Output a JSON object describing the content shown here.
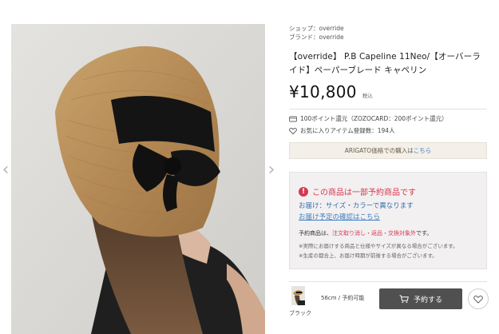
{
  "product": {
    "shop_line": "ショップ：override",
    "brand_line": "ブランド：override",
    "title": "【override】 P.B Capeline 11Neo/【オーバーライド】ペーパーブレード キャペリン",
    "price": "¥10,800",
    "tax_label": "税込",
    "points_text": "100ポイント還元（ZOZOCARD：200ポイント還元）",
    "favorites_text": "お気に入りアイテム登録数：194人"
  },
  "arigato": {
    "prefix": "ARIGATO価格での購入は",
    "link": "こちら"
  },
  "notice": {
    "headline": "この商品は一部予約商品です",
    "size_color": "お届け：サイズ・カラーで異なります",
    "check_link": "お届け予定の確認はこちら",
    "cancel_prefix": "予約商品は、",
    "cancel_red": "注文取り消し・返品・交換対象外",
    "cancel_suffix": "です。",
    "note_1": "※実際にお届けする商品と仕様やサイズが異なる場合がございます。",
    "note_2": "※生産の都合上、お届け時期が前後する場合がございます。"
  },
  "sku": {
    "color": "ブラック",
    "size_status": "56cm / 予約可能",
    "reserve_label": "予約する"
  },
  "colors": {
    "accent_red": "#d6384f",
    "link_blue": "#3a7ec2",
    "button_gray": "#505050"
  },
  "icons": {
    "prev": "chevron-left-icon",
    "next": "chevron-right-icon",
    "points": "points-card-icon",
    "favorite": "heart-outline-icon",
    "alert": "exclamation-circle-icon",
    "cart": "cart-icon"
  }
}
